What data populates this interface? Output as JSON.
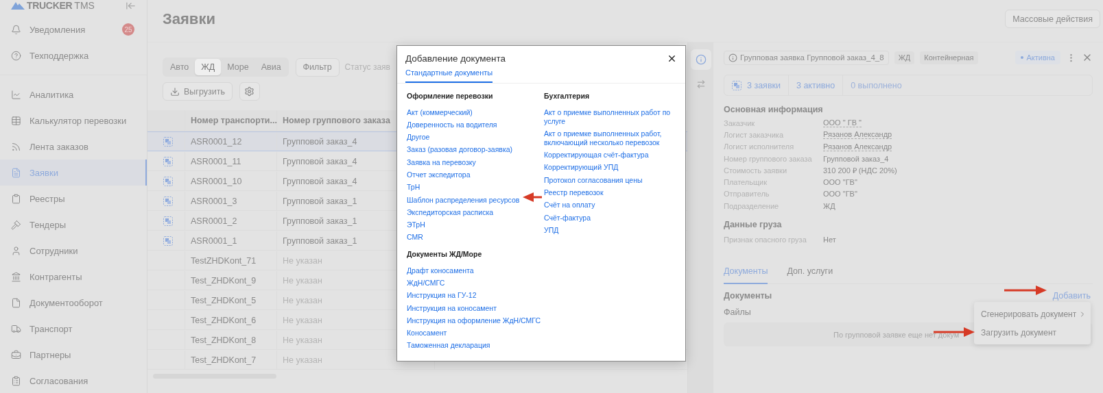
{
  "sidebar": {
    "logo": {
      "brand": "TRUCKER",
      "suffix": "TMS"
    },
    "top_items": [
      {
        "label": "Уведомления",
        "badge": "25",
        "selected": false
      },
      {
        "label": "Техподдержка",
        "selected": false
      }
    ],
    "items": [
      {
        "label": "Аналитика",
        "selected": false
      },
      {
        "label": "Калькулятор перевозки",
        "selected": false
      },
      {
        "label": "Лента заказов",
        "selected": false
      },
      {
        "label": "Заявки",
        "selected": true
      },
      {
        "label": "Реестры",
        "selected": false
      },
      {
        "label": "Тендеры",
        "selected": false
      },
      {
        "label": "Сотрудники",
        "selected": false
      },
      {
        "label": "Контрагенты",
        "selected": false
      },
      {
        "label": "Документооборот",
        "selected": false
      },
      {
        "label": "Транспорт",
        "selected": false
      },
      {
        "label": "Партнеры",
        "selected": false
      },
      {
        "label": "Согласования",
        "selected": false
      }
    ]
  },
  "page": {
    "title": "Заявки",
    "mass_action": "Массовые действия"
  },
  "toolbar": {
    "modes": [
      {
        "label": "Авто",
        "selected": false
      },
      {
        "label": "ЖД",
        "selected": true
      },
      {
        "label": "Море",
        "selected": false
      },
      {
        "label": "Авиа",
        "selected": false
      }
    ],
    "filter": "Фильтр",
    "status_filter": "Статус заяв",
    "export": "Выгрузить"
  },
  "table": {
    "columns": [
      "Номер транспорти...",
      "Номер группового заказа"
    ],
    "rows": [
      {
        "number": "ASR0001_12",
        "group": "Групповой заказ_4",
        "grouped": true,
        "empty": false,
        "selected": true
      },
      {
        "number": "ASR0001_11",
        "group": "Групповой заказ_4",
        "grouped": true,
        "empty": false,
        "selected": false
      },
      {
        "number": "ASR0001_10",
        "group": "Групповой заказ_4",
        "grouped": true,
        "empty": false,
        "selected": false
      },
      {
        "number": "ASR0001_3",
        "group": "Групповой заказ_1",
        "grouped": true,
        "empty": false,
        "selected": false
      },
      {
        "number": "ASR0001_2",
        "group": "Групповой заказ_1",
        "grouped": true,
        "empty": false,
        "selected": false
      },
      {
        "number": "ASR0001_1",
        "group": "Групповой заказ_1",
        "grouped": true,
        "empty": false,
        "selected": false
      },
      {
        "number": "TestZHDKont_71",
        "group": "Не указан",
        "grouped": false,
        "empty": true,
        "selected": false
      },
      {
        "number": "Test_ZHDKont_9",
        "group": "Не указан",
        "grouped": false,
        "empty": true,
        "selected": false
      },
      {
        "number": "Test_ZHDKont_5",
        "group": "Не указан",
        "grouped": false,
        "empty": true,
        "selected": false
      },
      {
        "number": "Test_ZHDKont_6",
        "group": "Не указан",
        "grouped": false,
        "empty": true,
        "selected": false
      },
      {
        "number": "Test_ZHDKont_8",
        "group": "Не указан",
        "grouped": false,
        "empty": true,
        "selected": false
      },
      {
        "number": "Test_ZHDKont_7",
        "group": "Не указан",
        "grouped": false,
        "empty": true,
        "selected": false
      }
    ]
  },
  "details": {
    "side_tabs": [
      {
        "selected": true
      },
      {
        "selected": false
      }
    ],
    "title": "Групповая заявка Групповой заказ_4_8",
    "tags": [
      "ЖД",
      "Контейнерная"
    ],
    "status": "Активна",
    "stats": [
      {
        "label": "3 заявки",
        "kind": "total"
      },
      {
        "label": "3 активно",
        "kind": "active"
      },
      {
        "label": "0 выполнено",
        "kind": "done"
      }
    ],
    "main_info": {
      "title": "Основная информация",
      "fields": [
        {
          "label": "Заказчик",
          "value": "ООО \" ГВ \"",
          "link": true
        },
        {
          "label": "Логист заказчика",
          "value": "Рязанов Александр",
          "link": true
        },
        {
          "label": "Логист исполнителя",
          "value": "Рязанов Александр",
          "link": true
        },
        {
          "label": "Номер группового заказа",
          "value": "Групповой заказ_4",
          "link": false
        },
        {
          "label": "Стоимость заявки",
          "value": "310 200 ₽ (НДС 20%)",
          "link": false
        },
        {
          "label": "Плательщик",
          "value": "ООО \"ГВ\"",
          "link": false
        },
        {
          "label": "Отправитель",
          "value": "ООО \"ГВ\"",
          "link": false
        },
        {
          "label": "Подразделение",
          "value": "ЖД",
          "link": false
        }
      ]
    },
    "cargo": {
      "title": "Данные груза",
      "fields": [
        {
          "label": "Признак опасного груза",
          "value": "Нет",
          "link": false
        }
      ]
    },
    "tabs": [
      {
        "label": "Документы",
        "selected": true
      },
      {
        "label": "Доп. услуги",
        "selected": false
      }
    ],
    "documents": {
      "title": "Документы",
      "add": "Добавить",
      "files_label": "Файлы",
      "empty_text": "По групповой заявке еще нет докум"
    },
    "add_menu": [
      {
        "label": "Сгенерировать документ",
        "submenu": true
      },
      {
        "label": "Загрузить документ",
        "submenu": false
      }
    ]
  },
  "modal": {
    "title": "Добавление документа",
    "tabs": [
      {
        "label": "Стандартные документы",
        "selected": true
      }
    ],
    "columns": [
      {
        "sections": [
          {
            "title": "Оформление перевозки",
            "items": [
              "Акт (коммерческий)",
              "Доверенность на водителя",
              "Другое",
              "Заказ (разовая договор-заявка)",
              "Заявка на перевозку",
              "Отчет экспедитора",
              "ТрН",
              "Шаблон распределения ресурсов",
              "Экспедиторская расписка",
              "ЭТрН",
              "CMR"
            ]
          },
          {
            "title": "Документы ЖД/Море",
            "items": [
              "Драфт коносамента",
              "ЖдН/СМГС",
              "Инструкция на ГУ-12",
              "Инструкция на коносамент",
              "Инструкция на оформление ЖдН/СМГС",
              "Коносамент",
              "Таможенная декларация"
            ]
          }
        ]
      },
      {
        "sections": [
          {
            "title": "Бухгалтерия",
            "items": [
              "Акт о приемке выполненных работ по услуге",
              "Акт о приемке выполненных работ, включающий несколько перевозок",
              "Корректирующая счёт-фактура",
              "Корректирующий УПД",
              "Протокол согласования цены",
              "Реестр перевозок",
              "Счёт на оплату",
              "Счёт-фактура",
              "УПД"
            ]
          }
        ]
      }
    ]
  }
}
